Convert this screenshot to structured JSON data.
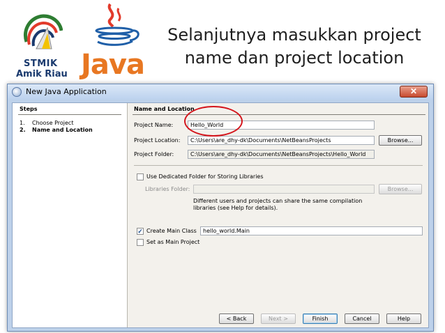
{
  "slide": {
    "title": "Selanjutnya masukkan project name dan project location",
    "logo_stmik": {
      "line1": "STMIK",
      "line2": "Amik Riau"
    },
    "logo_java": {
      "word": "Java"
    }
  },
  "window": {
    "title": "New Java Application",
    "close_label": "✕"
  },
  "steps": {
    "heading": "Steps",
    "items": [
      {
        "num": "1.",
        "label": "Choose Project"
      },
      {
        "num": "2.",
        "label": "Name and Location"
      }
    ]
  },
  "form": {
    "heading": "Name and Location",
    "project_name_label": "Project Name:",
    "project_name_value": "Hello_World",
    "project_location_label": "Project Location:",
    "project_location_value": "C:\\Users\\are_dhy-dk\\Documents\\NetBeansProjects",
    "browse_label": "Browse...",
    "project_folder_label": "Project Folder:",
    "project_folder_value": "C:\\Users\\are_dhy-dk\\Documents\\NetBeansProjects\\Hello_World",
    "dedicated_folder_label": "Use Dedicated Folder for Storing Libraries",
    "libraries_folder_label": "Libraries Folder:",
    "libraries_browse_label": "Browse...",
    "help_line1": "Different users and projects can share the same compilation",
    "help_line2": "libraries (see Help for details).",
    "create_main_class_label": "Create Main Class",
    "main_class_value": "hello_world.Main",
    "set_main_project_label": "Set as Main Project"
  },
  "buttons": {
    "back": "< Back",
    "next": "Next >",
    "finish": "Finish",
    "cancel": "Cancel",
    "help": "Help"
  },
  "checkbox_states": {
    "dedicated_folder": false,
    "create_main_class": true,
    "set_main_project": false
  },
  "colors": {
    "highlight_circle": "#d4151c",
    "java_orange": "#e87722",
    "stmik_blue": "#1a3a6e"
  }
}
